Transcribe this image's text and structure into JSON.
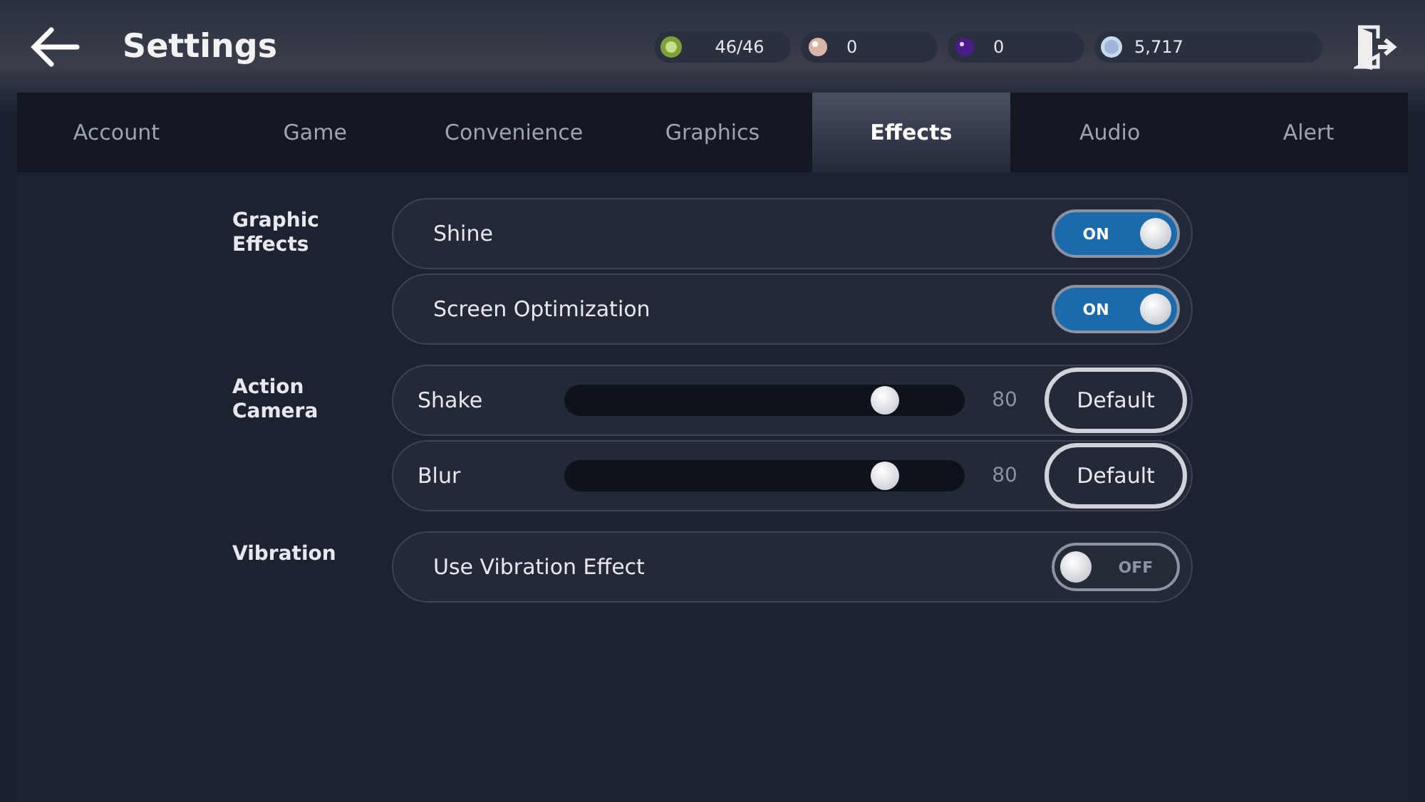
{
  "header": {
    "title": "Settings",
    "currencies": [
      {
        "kind": "stamina",
        "value": "46/46"
      },
      {
        "kind": "pearl",
        "value": "0"
      },
      {
        "kind": "orb",
        "value": "0"
      },
      {
        "kind": "coin",
        "value": "5,717"
      }
    ]
  },
  "tabs": [
    {
      "label": "Account",
      "selected": false
    },
    {
      "label": "Game",
      "selected": false
    },
    {
      "label": "Convenience",
      "selected": false
    },
    {
      "label": "Graphics",
      "selected": false
    },
    {
      "label": "Effects",
      "selected": true
    },
    {
      "label": "Audio",
      "selected": false
    },
    {
      "label": "Alert",
      "selected": false
    }
  ],
  "sections": [
    {
      "label": "Graphic Effects",
      "rows": [
        {
          "kind": "toggle",
          "label": "Shine",
          "on": true,
          "state_text": "ON"
        },
        {
          "kind": "toggle",
          "label": "Screen Optimization",
          "on": true,
          "state_text": "ON"
        }
      ]
    },
    {
      "label": "Action Camera",
      "rows": [
        {
          "kind": "slider",
          "label": "Shake",
          "level": 0.8,
          "reading": "80",
          "button": "Default"
        },
        {
          "kind": "slider",
          "label": "Blur",
          "level": 0.8,
          "reading": "80",
          "button": "Default"
        }
      ]
    },
    {
      "label": "Vibration",
      "rows": [
        {
          "kind": "toggle",
          "label": "Use Vibration Effect",
          "on": false,
          "state_text": "OFF"
        }
      ]
    }
  ]
}
